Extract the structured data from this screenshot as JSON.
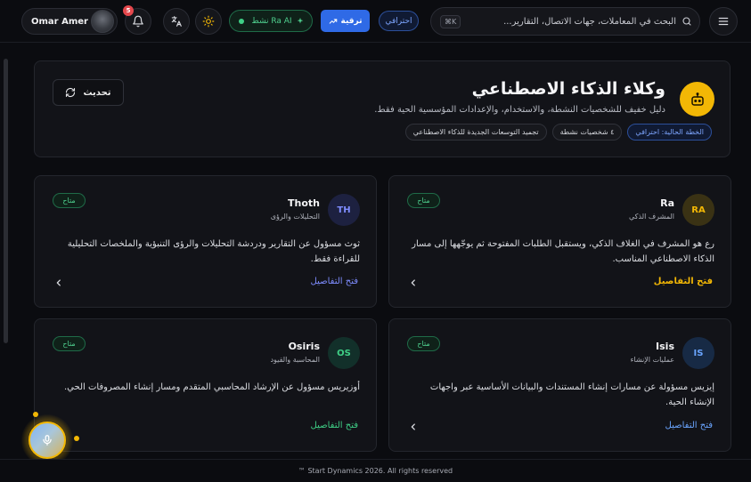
{
  "topbar": {
    "user_name": "Omar Amer",
    "notifications_count": "5",
    "ra_status_label": "Ra AI نشط",
    "upgrade_label": "ترقية",
    "plan_label": "احترافي",
    "search_placeholder": "البحث في المعاملات، جهات الاتصال، التقارير...",
    "search_shortcut": "⌘K"
  },
  "header": {
    "title": "وكلاء الذكاء الاصطناعي",
    "subtitle": "دليل خفيف للشخصيات النشطة، والاستخدام، والإعدادات المؤسسية الحية فقط.",
    "refresh_label": "تحديث",
    "chips": [
      "الخطة الحالية: احترافي",
      "٤ شخصيات نشطة",
      "تجميد التوسعات الجديدة للذكاء الاصطناعي"
    ]
  },
  "agents": [
    {
      "initials": "RA",
      "name": "Ra",
      "role": "المشرف الذكي",
      "status": "متاح",
      "description": "رع هو المشرف في الغلاف الذكي، ويستقبل الطلبات المفتوحة ثم يوجّهها إلى مسار الذكاء الاصطناعي المناسب.",
      "details_label": "فتح التفاصيل"
    },
    {
      "initials": "TH",
      "name": "Thoth",
      "role": "التحليلات والرؤى",
      "status": "متاح",
      "description": "ثوث مسؤول عن التقارير ودردشة التحليلات والرؤى التنبؤية والملخصات التحليلية للقراءة فقط.",
      "details_label": "فتح التفاصيل"
    },
    {
      "initials": "IS",
      "name": "Isis",
      "role": "عمليات الإنشاء",
      "status": "متاح",
      "description": "إيزيس مسؤولة عن مسارات إنشاء المستندات والبيانات الأساسية عبر واجهات الإنشاء الحية.",
      "details_label": "فتح التفاصيل"
    },
    {
      "initials": "OS",
      "name": "Osiris",
      "role": "المحاسبة والقيود",
      "status": "متاح",
      "description": "أوزيريس مسؤول عن الإرشاد المحاسبي المتقدم ومسار إنشاء المصروفات الحي.",
      "details_label": "فتح التفاصيل"
    }
  ],
  "footer": {
    "copyright": "™ Start Dynamics 2026. All rights reserved"
  },
  "colors": {
    "accent_gold": "#f2b705",
    "accent_blue": "#2f6ae6",
    "status_green": "#4fd08f"
  }
}
